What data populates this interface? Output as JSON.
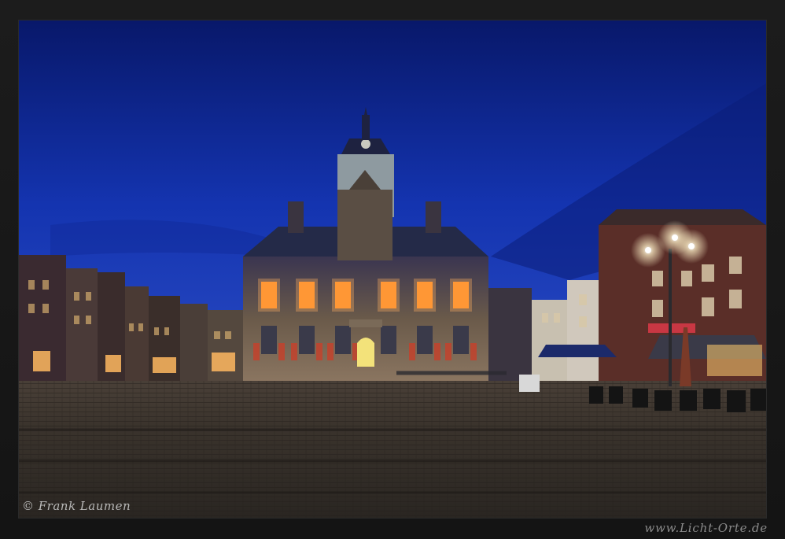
{
  "photo": {
    "subject": "Town hall at Markt square at blue hour",
    "colors": {
      "sky_top": "#0a1f7a",
      "sky_mid": "#1737b8",
      "sky_bottom": "#2548c8",
      "window_glow": "#ff8a1f",
      "facade": "#5a5048",
      "cobblestone": "#3a3530"
    }
  },
  "watermark": {
    "copyright": "© Frank Laumen",
    "website": "www.Licht-Orte.de"
  }
}
